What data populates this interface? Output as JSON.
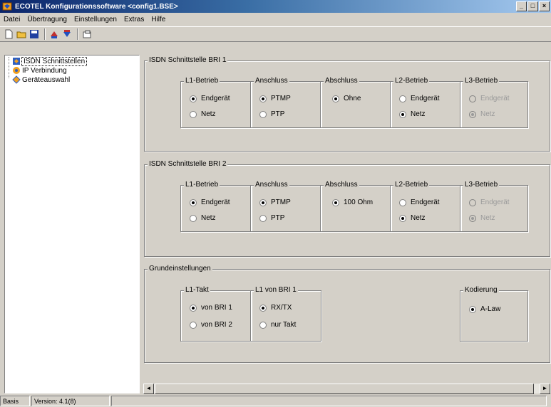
{
  "window": {
    "title": "ECOTEL Konfigurationssoftware <config1.BSE>"
  },
  "menu": [
    "Datei",
    "Übertragung",
    "Einstellungen",
    "Extras",
    "Hilfe"
  ],
  "tree": [
    {
      "label": "ISDN Schnittstellen",
      "icon": "isdn-icon"
    },
    {
      "label": "IP Verbindung",
      "icon": "network-icon"
    },
    {
      "label": "Geräteauswahl",
      "icon": "device-icon"
    }
  ],
  "bri1": {
    "title": "ISDN Schnittstelle BRI 1",
    "l1": {
      "title": "L1-Betrieb",
      "options": [
        "Endgerät",
        "Netz"
      ],
      "selected": 0
    },
    "anschluss": {
      "title": "Anschluss",
      "options": [
        "PTMP",
        "PTP"
      ],
      "selected": 0
    },
    "abschluss": {
      "title": "Abschluss",
      "options": [
        "Ohne"
      ],
      "selected": 0
    },
    "l2": {
      "title": "L2-Betrieb",
      "options": [
        "Endgerät",
        "Netz"
      ],
      "selected": 1
    },
    "l3": {
      "title": "L3-Betrieb",
      "options": [
        "Endgerät",
        "Netz"
      ],
      "selected": 1,
      "disabled": true
    }
  },
  "bri2": {
    "title": "ISDN Schnittstelle BRI 2",
    "l1": {
      "title": "L1-Betrieb",
      "options": [
        "Endgerät",
        "Netz"
      ],
      "selected": 0
    },
    "anschluss": {
      "title": "Anschluss",
      "options": [
        "PTMP",
        "PTP"
      ],
      "selected": 0
    },
    "abschluss": {
      "title": "Abschluss",
      "options": [
        "100 Ohm"
      ],
      "selected": 0
    },
    "l2": {
      "title": "L2-Betrieb",
      "options": [
        "Endgerät",
        "Netz"
      ],
      "selected": 1
    },
    "l3": {
      "title": "L3-Betrieb",
      "options": [
        "Endgerät",
        "Netz"
      ],
      "selected": 1,
      "disabled": true
    }
  },
  "basic": {
    "title": "Grundeinstellungen",
    "takt": {
      "title": "L1-Takt",
      "options": [
        "von BRI 1",
        "von BRI 2"
      ],
      "selected": 0
    },
    "l1bri1": {
      "title": "L1 von BRI 1",
      "options": [
        "RX/TX",
        "nur Takt"
      ],
      "selected": 0
    },
    "kodierung": {
      "title": "Kodierung",
      "options": [
        "A-Law"
      ],
      "selected": 0
    }
  },
  "status": {
    "mode": "Basis",
    "version": "Version: 4.1(8)"
  }
}
